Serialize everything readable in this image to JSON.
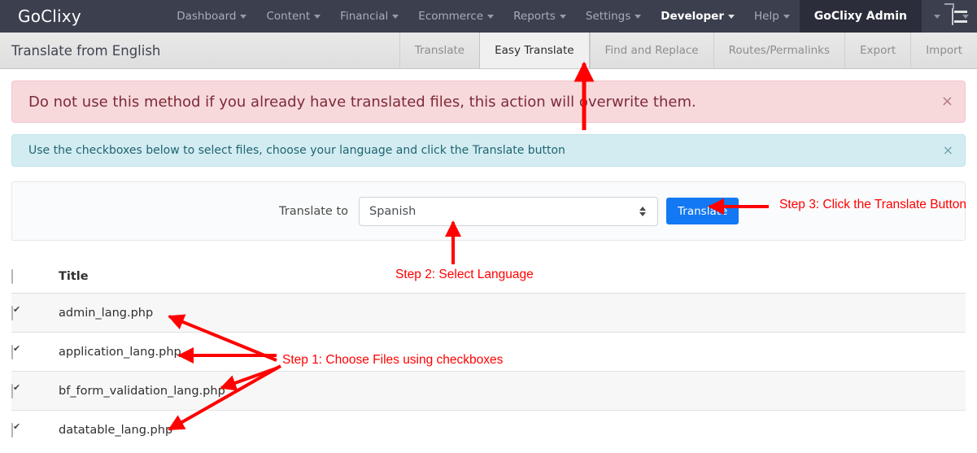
{
  "navbar": {
    "brand": "GoClixy",
    "menu": [
      {
        "label": "Dashboard",
        "has_caret": true,
        "active": false
      },
      {
        "label": "Content",
        "has_caret": true,
        "active": false
      },
      {
        "label": "Financial",
        "has_caret": true,
        "active": false
      },
      {
        "label": "Ecommerce",
        "has_caret": true,
        "active": false
      },
      {
        "label": "Reports",
        "has_caret": true,
        "active": false
      },
      {
        "label": "Settings",
        "has_caret": true,
        "active": false
      },
      {
        "label": "Developer",
        "has_caret": true,
        "active": true
      },
      {
        "label": "Help",
        "has_caret": true,
        "active": false
      }
    ],
    "user_label": "GoClixy Admin",
    "user_caret_icon": "chevron-down-icon",
    "keyboard_icon": "keyboard-icon",
    "keyboard_caret_icon": "chevron-down-icon",
    "background_color": "#3b3f4e",
    "user_background_color": "#2b2e3a"
  },
  "subheader": {
    "title": "Translate from English",
    "tabs": [
      {
        "label": "Translate",
        "active": false
      },
      {
        "label": "Easy Translate",
        "active": true
      },
      {
        "label": "Find and Replace",
        "active": false
      },
      {
        "label": "Routes/Permalinks",
        "active": false
      },
      {
        "label": "Export",
        "active": false
      },
      {
        "label": "Import",
        "active": false
      }
    ]
  },
  "alerts": [
    {
      "type": "danger",
      "message": "Do not use this method if you already have translated files, this action will overwrite them.",
      "close_label": "×",
      "background_color": "#f7d9dc",
      "text_color": "#7d2b36"
    },
    {
      "type": "info",
      "message": "Use the checkboxes below to select files, choose your language and click the Translate button",
      "close_label": "×",
      "background_color": "#d3ecf2",
      "text_color": "#1f6571"
    }
  ],
  "form": {
    "label": "Translate to",
    "select_name": "language-select",
    "selected_value": "Spanish",
    "select_arrows_icon": "updown-arrows-icon",
    "button_label": "Translate",
    "button_color": "#1278f3"
  },
  "table": {
    "header_checkbox_checked": false,
    "columns": [
      "",
      "Title"
    ],
    "rows": [
      {
        "checked": true,
        "title": "admin_lang.php"
      },
      {
        "checked": true,
        "title": "application_lang.php"
      },
      {
        "checked": true,
        "title": "bf_form_validation_lang.php"
      },
      {
        "checked": true,
        "title": "datatable_lang.php"
      }
    ]
  },
  "annotations": {
    "color": "#ff0000",
    "step1": "Step 1: Choose Files using checkboxes",
    "step2": "Step 2: Select Language",
    "step3": "Step 3: Click the Translate Button"
  }
}
